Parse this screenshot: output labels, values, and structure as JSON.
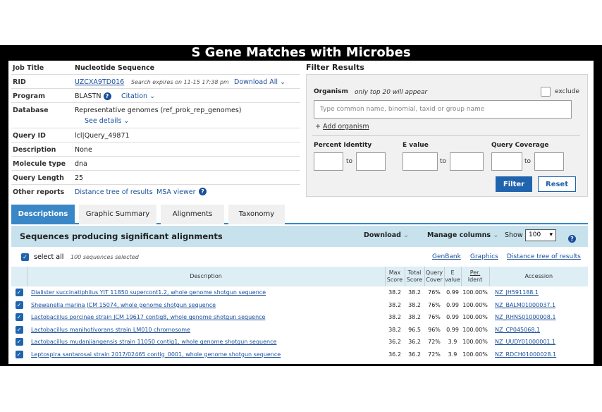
{
  "banner_title": "S Gene Matches with Microbes",
  "job": {
    "title_label": "Job Title",
    "title_value": "Nucleotide Sequence",
    "rid_label": "RID",
    "rid_value": "UZCXA9TD016",
    "rid_expiry": "Search expires on 11-15 17:38 pm",
    "download_all": "Download All",
    "program_label": "Program",
    "program_value": "BLASTN",
    "citation": "Citation",
    "database_label": "Database",
    "database_value": "Representative genomes (ref_prok_rep_genomes)",
    "see_details": "See details",
    "queryid_label": "Query ID",
    "queryid_value": "lcl|Query_49871",
    "description_label": "Description",
    "description_value": "None",
    "moltype_label": "Molecule type",
    "moltype_value": "dna",
    "querylength_label": "Query Length",
    "querylength_value": "25",
    "otherreports_label": "Other reports",
    "distance_tree": "Distance tree of results",
    "msa_viewer": "MSA viewer"
  },
  "filter": {
    "title": "Filter Results",
    "organism_label": "Organism",
    "organism_note": "only top 20 will appear",
    "exclude_label": "exclude",
    "organism_placeholder": "Type common name, binomial, taxid or group name",
    "add_organism": "Add organism",
    "percent_identity": "Percent Identity",
    "e_value": "E value",
    "query_coverage": "Query Coverage",
    "to": "to",
    "filter_button": "Filter",
    "reset_button": "Reset"
  },
  "tabs": [
    "Descriptions",
    "Graphic Summary",
    "Alignments",
    "Taxonomy"
  ],
  "results": {
    "title": "Sequences producing significant alignments",
    "download": "Download",
    "manage_columns": "Manage columns",
    "show_label": "Show",
    "show_value": "100",
    "select_all": "select all",
    "selected_count": "100 sequences selected",
    "genbank": "GenBank",
    "graphics": "Graphics",
    "distance_tree": "Distance tree of results",
    "columns": {
      "description": "Description",
      "max_score": [
        "Max",
        "Score"
      ],
      "total_score": [
        "Total",
        "Score"
      ],
      "query_cover": [
        "Query",
        "Cover"
      ],
      "e_value": [
        "E",
        "value"
      ],
      "per_ident": [
        "Per.",
        "Ident"
      ],
      "accession": "Accession"
    },
    "rows": [
      {
        "description": "Dialister succinatiphilus YIT 11850 supercont1.2, whole genome shotgun sequence",
        "max": "38.2",
        "total": "38.2",
        "cover": "76%",
        "evalue": "0.99",
        "ident": "100.00%",
        "accession": "NZ_JH591188.1"
      },
      {
        "description": "Shewanella marina JCM 15074, whole genome shotgun sequence",
        "max": "38.2",
        "total": "38.2",
        "cover": "76%",
        "evalue": "0.99",
        "ident": "100.00%",
        "accession": "NZ_BALM01000037.1"
      },
      {
        "description": "Lactobacillus porcinae strain JCM 19617 contig8, whole genome shotgun sequence",
        "max": "38.2",
        "total": "38.2",
        "cover": "76%",
        "evalue": "0.99",
        "ident": "100.00%",
        "accession": "NZ_RHNS01000008.1"
      },
      {
        "description": "Lactobacillus manihotivorans strain LM010 chromosome",
        "max": "38.2",
        "total": "96.5",
        "cover": "96%",
        "evalue": "0.99",
        "ident": "100.00%",
        "accession": "NZ_CP045068.1"
      },
      {
        "description": "Lactobacillus mudanjiangensis strain 11050 contig1, whole genome shotgun sequence",
        "max": "36.2",
        "total": "36.2",
        "cover": "72%",
        "evalue": "3.9",
        "ident": "100.00%",
        "accession": "NZ_UUDY01000001.1"
      },
      {
        "description": "Leptospira santarosai strain 2017/02465 contig_0001, whole genome shotgun sequence",
        "max": "36.2",
        "total": "36.2",
        "cover": "72%",
        "evalue": "3.9",
        "ident": "100.00%",
        "accession": "NZ_RDCH01000028.1"
      }
    ]
  },
  "colors": {
    "accent": "#3a87c8",
    "link": "#1a4f9c",
    "header_band": "#c7e2ec",
    "button": "#1f64ad"
  }
}
